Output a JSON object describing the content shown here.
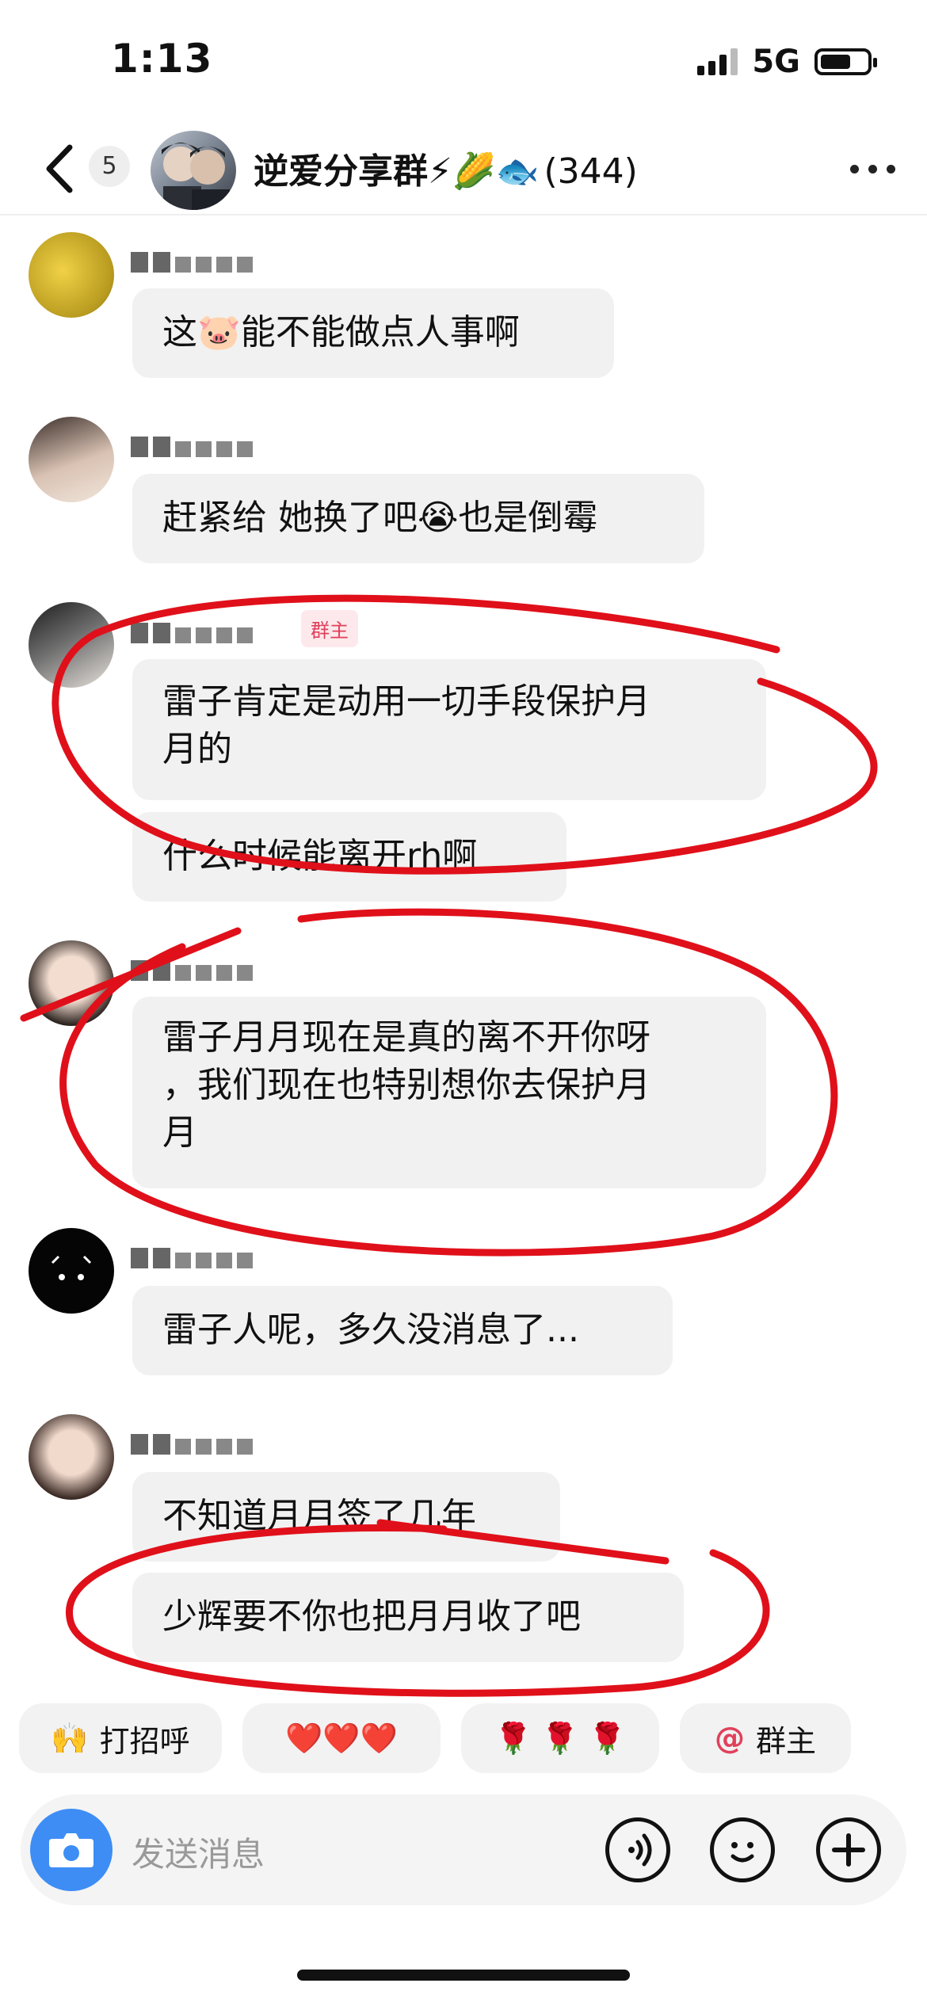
{
  "status": {
    "time": "1:13",
    "network": "5G"
  },
  "header": {
    "unread_count": "5",
    "group_name": "逆爱分享群⚡🌽🐟",
    "member_count": "(344)"
  },
  "messages": [
    {
      "text": "这🐷能不能做点人事啊"
    },
    {
      "text": "赶紧给 她换了吧😭也是倒霉"
    },
    {
      "badge": "群主",
      "line1": "雷子肯定是动用一切手段保护月",
      "line2": "月的",
      "text2": "什么时候能离开rh啊"
    },
    {
      "line1": "雷子月月现在是真的离不开你呀",
      "line2": "，我们现在也特别想你去保护月",
      "line3": "月"
    },
    {
      "text": "雷子人呢，多久没消息了..."
    },
    {
      "text": "不知道月月签了几年",
      "text2": "少辉要不你也把月月收了吧"
    }
  ],
  "quick_replies": [
    {
      "label": "打招呼",
      "icon": "🙌"
    },
    {
      "label": "❤️❤️❤️"
    },
    {
      "label": "🌹 🌹 🌹"
    },
    {
      "label": "群主",
      "icon": "@"
    }
  ],
  "input": {
    "placeholder": "发送消息"
  },
  "colors": {
    "accent": "#3d8df5",
    "annotation": "#e0101a",
    "owner_badge": "#e0415b"
  }
}
